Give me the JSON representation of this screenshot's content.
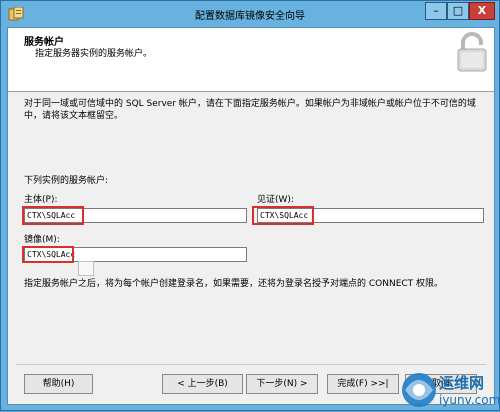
{
  "window": {
    "title": "配置数据库镜像安全向导",
    "controls": {
      "minimize": "–",
      "maximize": "□",
      "close": "X"
    }
  },
  "header": {
    "title": "服务帐户",
    "subtitle": "指定服务器实例的服务帐户。"
  },
  "intro_text": "对于同一域或可信域中的 SQL Server 帐户，请在下面指定服务帐户。如果帐户为非域帐户或帐户位于不可信的域中，请将该文本框留空。",
  "section_label": "下列实例的服务帐户:",
  "fields": {
    "principal": {
      "label": "主体(P):",
      "value": "CTX\\SQLAcc"
    },
    "witness": {
      "label": "见证(W):",
      "value": "CTX\\SQLAcc"
    },
    "mirror": {
      "label": "镜像(M):",
      "value": "CTX\\SQLAcc"
    }
  },
  "note_text": "指定服务帐户之后，将为每个帐户创建登录名，如果需要，还将为登录名授予对端点的 CONNECT 权限。",
  "buttons": {
    "help": "帮助(H)",
    "back": "< 上一步(B)",
    "next": "下一步(N) >",
    "finish": "完成(F) >>|",
    "cancel": "取消"
  },
  "watermark": {
    "brand_cn": "运维网",
    "brand_url": "iyunv.com"
  },
  "colors": {
    "title_bar": "#68b2e0",
    "close_button": "#c7403a",
    "highlight_box": "#d8302e",
    "dialog_bg": "#f0f0f0"
  }
}
